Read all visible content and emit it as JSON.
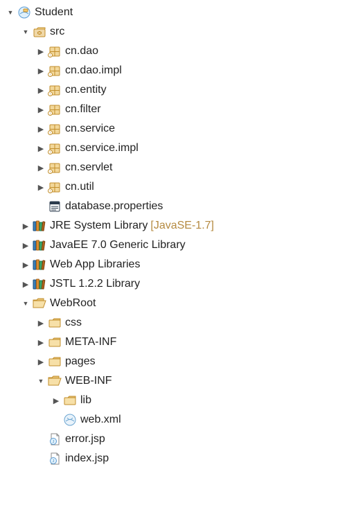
{
  "tree": {
    "root": {
      "label": "Student",
      "icon": "project",
      "state": "expanded",
      "indent": 0
    },
    "items": [
      {
        "label": "src",
        "icon": "src-folder",
        "state": "expanded",
        "indent": 1
      },
      {
        "label": "cn.dao",
        "icon": "package",
        "state": "collapsed",
        "indent": 2
      },
      {
        "label": "cn.dao.impl",
        "icon": "package",
        "state": "collapsed",
        "indent": 2
      },
      {
        "label": "cn.entity",
        "icon": "package",
        "state": "collapsed",
        "indent": 2
      },
      {
        "label": "cn.filter",
        "icon": "package",
        "state": "collapsed",
        "indent": 2
      },
      {
        "label": "cn.service",
        "icon": "package",
        "state": "collapsed",
        "indent": 2
      },
      {
        "label": "cn.service.impl",
        "icon": "package",
        "state": "collapsed",
        "indent": 2
      },
      {
        "label": "cn.servlet",
        "icon": "package",
        "state": "collapsed",
        "indent": 2
      },
      {
        "label": "cn.util",
        "icon": "package",
        "state": "collapsed",
        "indent": 2
      },
      {
        "label": "database.properties",
        "icon": "properties",
        "state": "none",
        "indent": 2
      },
      {
        "label": "JRE System Library",
        "suffix": "[JavaSE-1.7]",
        "icon": "library",
        "state": "collapsed",
        "indent": 1
      },
      {
        "label": "JavaEE 7.0 Generic Library",
        "icon": "library",
        "state": "collapsed",
        "indent": 1
      },
      {
        "label": "Web App Libraries",
        "icon": "library",
        "state": "collapsed",
        "indent": 1
      },
      {
        "label": "JSTL 1.2.2 Library",
        "icon": "library",
        "state": "collapsed",
        "indent": 1
      },
      {
        "label": "WebRoot",
        "icon": "folder-open",
        "state": "expanded",
        "indent": 1
      },
      {
        "label": "css",
        "icon": "folder",
        "state": "collapsed",
        "indent": 2
      },
      {
        "label": "META-INF",
        "icon": "folder",
        "state": "collapsed",
        "indent": 2
      },
      {
        "label": "pages",
        "icon": "folder",
        "state": "collapsed",
        "indent": 2
      },
      {
        "label": "WEB-INF",
        "icon": "folder-open",
        "state": "expanded",
        "indent": 2
      },
      {
        "label": "lib",
        "icon": "folder",
        "state": "collapsed",
        "indent": 3
      },
      {
        "label": "web.xml",
        "icon": "xml",
        "state": "none",
        "indent": 3
      },
      {
        "label": "error.jsp",
        "icon": "jsp",
        "state": "none",
        "indent": 2
      },
      {
        "label": "index.jsp",
        "icon": "jsp",
        "state": "none",
        "indent": 2
      }
    ]
  }
}
